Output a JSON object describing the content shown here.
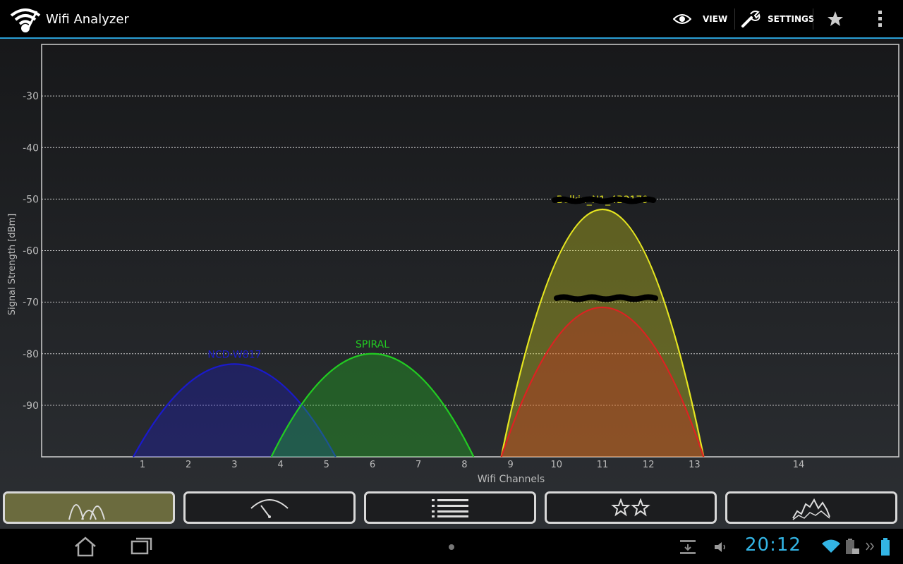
{
  "app": {
    "title": "Wifi Analyzer"
  },
  "actionbar": {
    "view_label": "VIEW",
    "settings_label": "SETTINGS"
  },
  "chart_data": {
    "type": "area",
    "xlabel": "Wifi Channels",
    "ylabel": "Signal Strength [dBm]",
    "x_ticks": [
      1,
      2,
      3,
      4,
      5,
      6,
      7,
      8,
      9,
      10,
      11,
      12,
      13,
      14
    ],
    "y_ticks": [
      -30,
      -40,
      -50,
      -60,
      -70,
      -80,
      -90
    ],
    "ylim": [
      -100,
      -20
    ],
    "grid": true,
    "series": [
      {
        "name": "NCD-W817",
        "center_channel": 3,
        "signal_dbm": -82,
        "color": "#1a1acc",
        "label_obscured": false
      },
      {
        "name": "SPIRAL",
        "center_channel": 6,
        "signal_dbm": -80,
        "color": "#22cc22",
        "label_obscured": false
      },
      {
        "name": "Belkin_N1_4B3179",
        "center_channel": 11,
        "signal_dbm": -52,
        "color": "#e6e620",
        "label_obscured": true
      },
      {
        "name": "",
        "center_channel": 11,
        "signal_dbm": -71,
        "color": "#dd2222",
        "label_obscured": true
      }
    ]
  },
  "tabs": [
    {
      "icon": "channel-graph-icon",
      "active": true
    },
    {
      "icon": "signal-meter-icon",
      "active": false
    },
    {
      "icon": "ap-list-icon",
      "active": false
    },
    {
      "icon": "channel-rating-icon",
      "active": false
    },
    {
      "icon": "time-graph-icon",
      "active": false
    }
  ],
  "status": {
    "time": "20:12"
  }
}
